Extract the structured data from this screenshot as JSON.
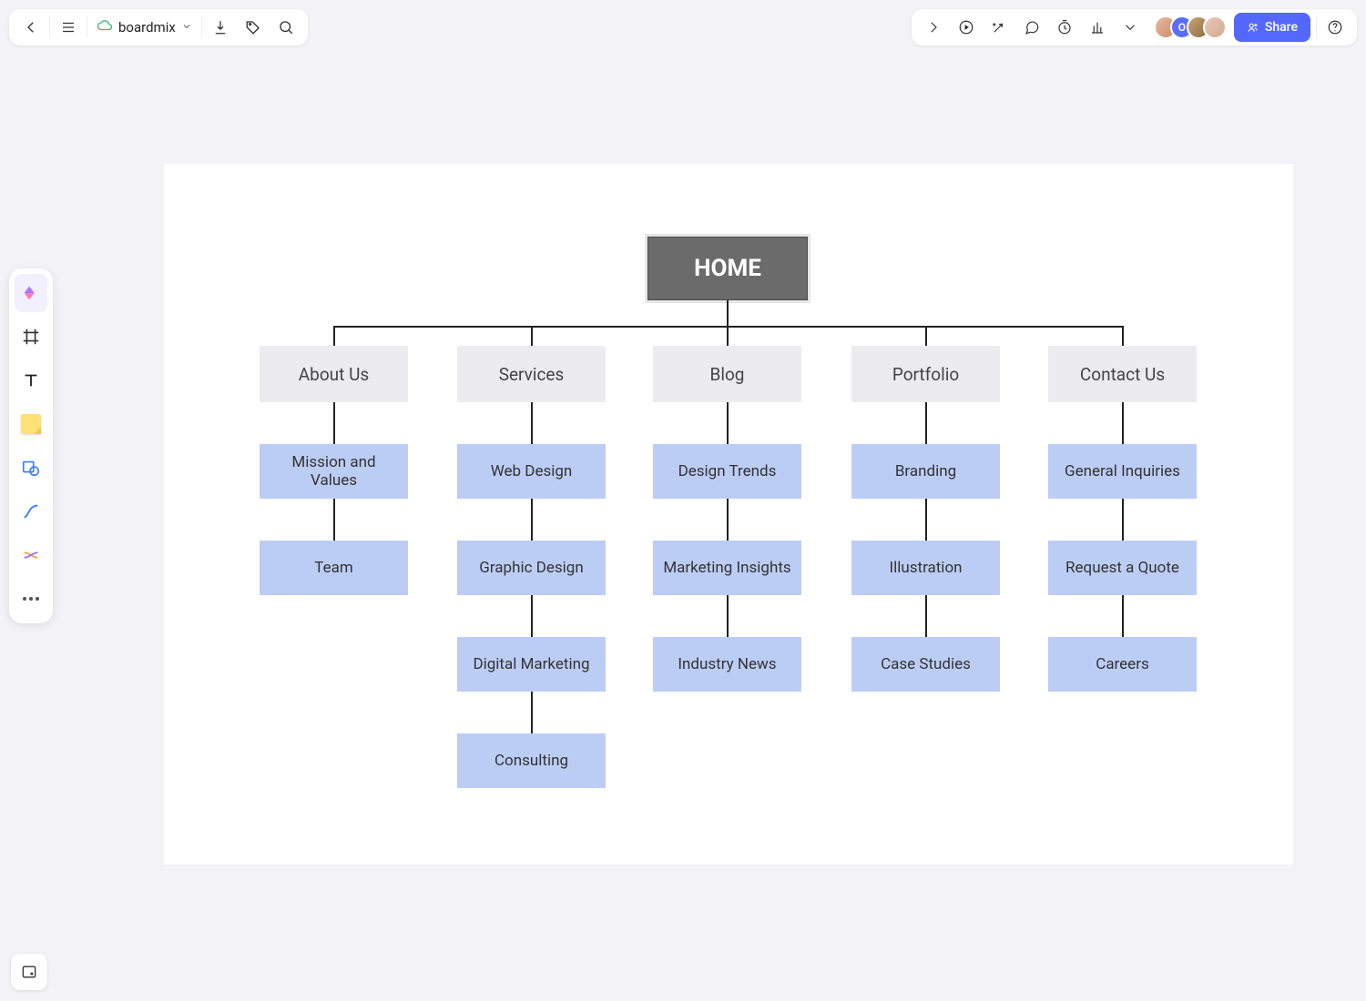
{
  "header": {
    "title": "boardmix",
    "share_label": "Share",
    "avatar_letter": "O"
  },
  "diagram": {
    "root": "HOME",
    "columns": [
      {
        "category": "About Us",
        "items": [
          "Mission and Values",
          "Team"
        ]
      },
      {
        "category": "Services",
        "items": [
          "Web Design",
          "Graphic Design",
          "Digital Marketing",
          "Consulting"
        ]
      },
      {
        "category": "Blog",
        "items": [
          "Design Trends",
          "Marketing Insights",
          "Industry News"
        ]
      },
      {
        "category": "Portfolio",
        "items": [
          "Branding",
          "Illustration",
          "Case Studies"
        ]
      },
      {
        "category": "Contact Us",
        "items": [
          "General Inquiries",
          "Request a Quote",
          "Careers"
        ]
      }
    ]
  }
}
